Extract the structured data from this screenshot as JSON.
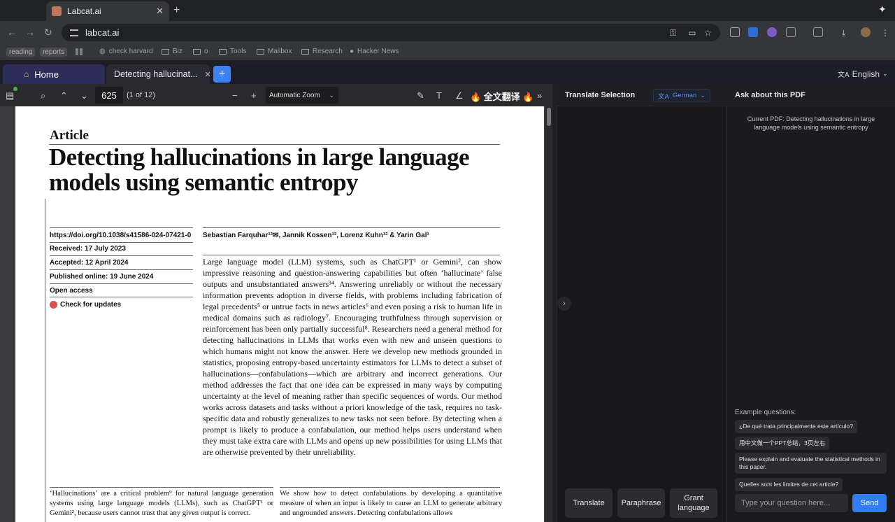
{
  "browser": {
    "tab_title": "Labcat.ai",
    "url": "labcat.ai",
    "bookmarks": [
      "reading",
      "reports",
      "check harvard",
      "Biz",
      "o",
      "Tools",
      "Mailbox",
      "Research",
      "Hacker News"
    ]
  },
  "app": {
    "home_tab": "Home",
    "doc_tab": "Detecting hallucinat...",
    "language": "English"
  },
  "pdf_toolbar": {
    "page_number": "625",
    "page_count": "(1 of 12)",
    "zoom": "Automatic Zoom",
    "full_translate": "🔥 全文翻译 🔥"
  },
  "paper": {
    "article_label": "Article",
    "title": "Detecting hallucinations in large language models using semantic entropy",
    "doi": "https://doi.org/10.1038/s41586-024-07421-0",
    "received": "Received: 17 July 2023",
    "accepted": "Accepted: 12 April 2024",
    "published": "Published online: 19 June 2024",
    "open_access": "Open access",
    "check_updates": "Check for updates",
    "authors": "Sebastian Farquhar¹²✉, Jannik Kossen¹², Lorenz Kuhn¹² & Yarin Gal¹",
    "abstract": "Large language model (LLM) systems, such as ChatGPT¹ or Gemini², can show impressive reasoning and question-answering capabilities but often ‘hallucinate’ false outputs and unsubstantiated answers³⁴. Answering unreliably or without the necessary information prevents adoption in diverse fields, with problems including fabrication of legal precedents⁵ or untrue facts in news articles⁶ and even posing a risk to human life in medical domains such as radiology⁷. Encouraging truthfulness through supervision or reinforcement has been only partially successful⁸. Researchers need a general method for detecting hallucinations in LLMs that works even with new and unseen questions to which humans might not know the answer. Here we develop new methods grounded in statistics, proposing entropy-based uncertainty estimators for LLMs to detect a subset of hallucinations—confabulations—which are arbitrary and incorrect generations. Our method addresses the fact that one idea can be expressed in many ways by computing uncertainty at the level of meaning rather than specific sequences of words. Our method works across datasets and tasks without a priori knowledge of the task, requires no task-specific data and robustly generalizes to new tasks not seen before. By detecting when a prompt is likely to produce a confabulation, our method helps users understand when they must take extra care with LLMs and opens up new possibilities for using LLMs that are otherwise prevented by their unreliability.",
    "body_col1": "‘Hallucinations’ are a critical problem⁹ for natural language generation systems using large language models (LLMs), such as ChatGPT¹ or Gemini², because users cannot trust that any given output is correct.",
    "body_col2": "We show how to detect confabulations by developing a quantitative measure of when an input is likely to cause an LLM to generate arbitrary and ungrounded answers. Detecting confabulations allows"
  },
  "translate_panel": {
    "title": "Translate Selection",
    "target_language": "German",
    "buttons": [
      "Translate",
      "Paraphrase",
      "Grant language"
    ]
  },
  "ask_panel": {
    "title": "Ask about this PDF",
    "current_pdf": "Current PDF: Detecting hallucinations in large language models using semantic entropy",
    "examples_label": "Example questions:",
    "examples": [
      "¿De qué trata principalmente este artículo?",
      "用中文做一个PPT总结，3页左右",
      "Please explain and evaluate the statistical methods in this paper.",
      "Quelles sont les limites de cet article?"
    ],
    "input_placeholder": "Type your question here...",
    "send_label": "Send"
  },
  "colors": {
    "accent_blue": "#3b82f6",
    "send_blue": "#2f7df0",
    "home_tab": "#2d2d5a"
  }
}
